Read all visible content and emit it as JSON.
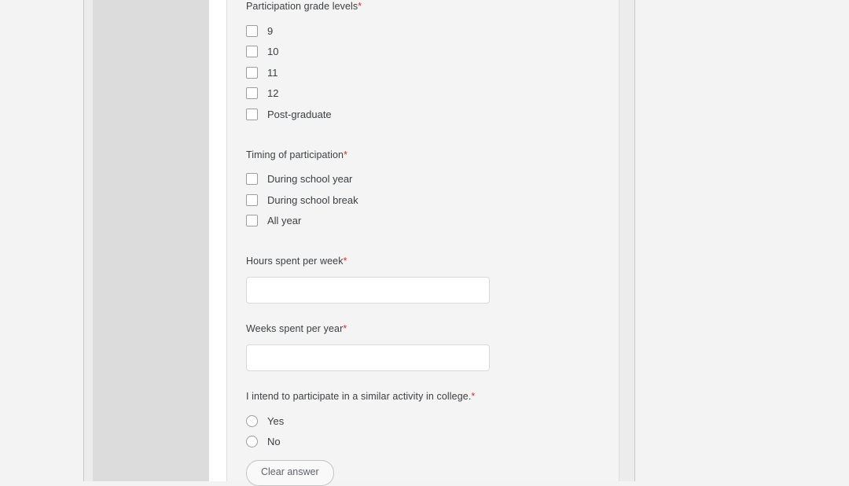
{
  "colors": {
    "page_background": "#f3f3f3",
    "card_background": "#f4f4f4",
    "side_band_gray": "#dcdcdc",
    "required_asterisk": "#d93025",
    "label_text": "#3c4043",
    "control_border": "#9e9e9e"
  },
  "form": {
    "questions": [
      {
        "id": "participation-grade-levels",
        "label": "Participation grade levels",
        "required_marker": "*",
        "type": "checkbox",
        "options": [
          {
            "label": "9",
            "checked": false
          },
          {
            "label": "10",
            "checked": false
          },
          {
            "label": "11",
            "checked": false
          },
          {
            "label": "12",
            "checked": false
          },
          {
            "label": "Post-graduate",
            "checked": false
          }
        ]
      },
      {
        "id": "timing-of-participation",
        "label": "Timing of participation",
        "required_marker": "*",
        "type": "checkbox",
        "options": [
          {
            "label": "During school year",
            "checked": false
          },
          {
            "label": "During school break",
            "checked": false
          },
          {
            "label": "All year",
            "checked": false
          }
        ]
      },
      {
        "id": "hours-spent-per-week",
        "label": "Hours spent per week",
        "required_marker": "*",
        "type": "text",
        "value": "",
        "placeholder": ""
      },
      {
        "id": "weeks-spent-per-year",
        "label": "Weeks spent per year",
        "required_marker": "*",
        "type": "text",
        "value": "",
        "placeholder": ""
      },
      {
        "id": "intend-similar-activity-college",
        "label": "I intend to participate in a similar activity in college.",
        "required_marker": "*",
        "type": "radio",
        "options": [
          {
            "label": "Yes",
            "selected": false
          },
          {
            "label": "No",
            "selected": false
          }
        ],
        "clear_answer_label": "Clear answer"
      }
    ]
  }
}
